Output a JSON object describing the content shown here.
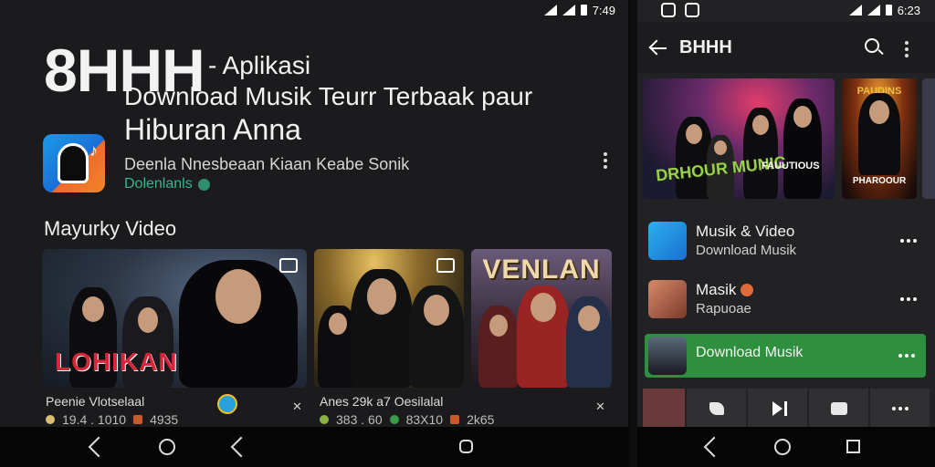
{
  "left": {
    "status_time": "7:49",
    "title_big": "8HHH",
    "title_suffix": "- Aplikasi",
    "title_line2": "Download Musik Teurr Terbaak paur",
    "title_line3": "Hiburan Anna",
    "app_desc": "Deenla Nnesbeaan Kiaan Keabe Sonik",
    "app_developer": "Dolenlanls",
    "section_title": "Mayurky Video",
    "videos": [
      {
        "title": "Peenie Vlotselaal",
        "meta1": "19.4 . 1010",
        "meta2": "4935",
        "logo": "LOHIKAN"
      },
      {
        "title": "Anes 29k a7 Oesilalal",
        "meta1": "383 . 60",
        "meta2": "83X10",
        "meta3": "2k65",
        "logo": ""
      },
      {
        "title": "",
        "meta1": "",
        "meta2": "",
        "logo": "VENLAN"
      }
    ]
  },
  "right": {
    "status_time": "6:23",
    "title": "BHHH",
    "banners": [
      {
        "logo": "DRHOUR MUNIC",
        "caption": "FAUUTIOUS"
      },
      {
        "top": "PAUDINS",
        "bottom": "PHAROOUR"
      }
    ],
    "list": [
      {
        "title": "Musik & Video",
        "subtitle": "Download Musik"
      },
      {
        "title": "Masik",
        "subtitle": "Rapuoae"
      },
      {
        "title": "Download Musik",
        "subtitle": ""
      }
    ]
  },
  "colors": {
    "accent_green": "#2e8f3e",
    "developer_green": "#38b58c",
    "background": "#1b1b1d"
  }
}
